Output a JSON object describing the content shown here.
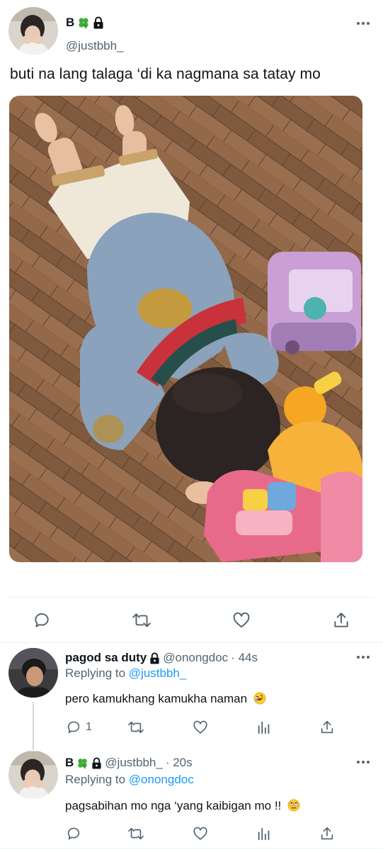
{
  "main_tweet": {
    "display_name": "B",
    "handle": "@justbbh_",
    "text": "buti na lang talaga ‘di ka nagmana sa tatay mo",
    "badges": [
      "four-leaf-clover-icon",
      "lock-icon"
    ],
    "actions": [
      "reply-icon",
      "retweet-icon",
      "like-icon",
      "share-icon"
    ]
  },
  "replies": [
    {
      "display_name": "pagod sa duty",
      "handle": "@onongdoc",
      "time": "· 44s",
      "replying_label": "Replying to",
      "replying_to": "@justbbh_",
      "text": "pero kamukhang kamukha naman",
      "emoji": "rolling-on-floor-laughing-emoji",
      "reply_count": "1"
    },
    {
      "display_name": "B",
      "handle": "@justbbh_",
      "time": "· 20s",
      "replying_label": "Replying to",
      "replying_to": "@onongdoc",
      "text": "pagsabihan mo nga ‘yang kaibigan mo !!",
      "emoji": "face-with-rolling-eyes-emoji",
      "reply_count": ""
    }
  ],
  "colors": {
    "text": "#0f1419",
    "secondary": "#536471",
    "link": "#1d9bf0",
    "divider": "#eff3f4",
    "clover": "#3fae3a"
  }
}
